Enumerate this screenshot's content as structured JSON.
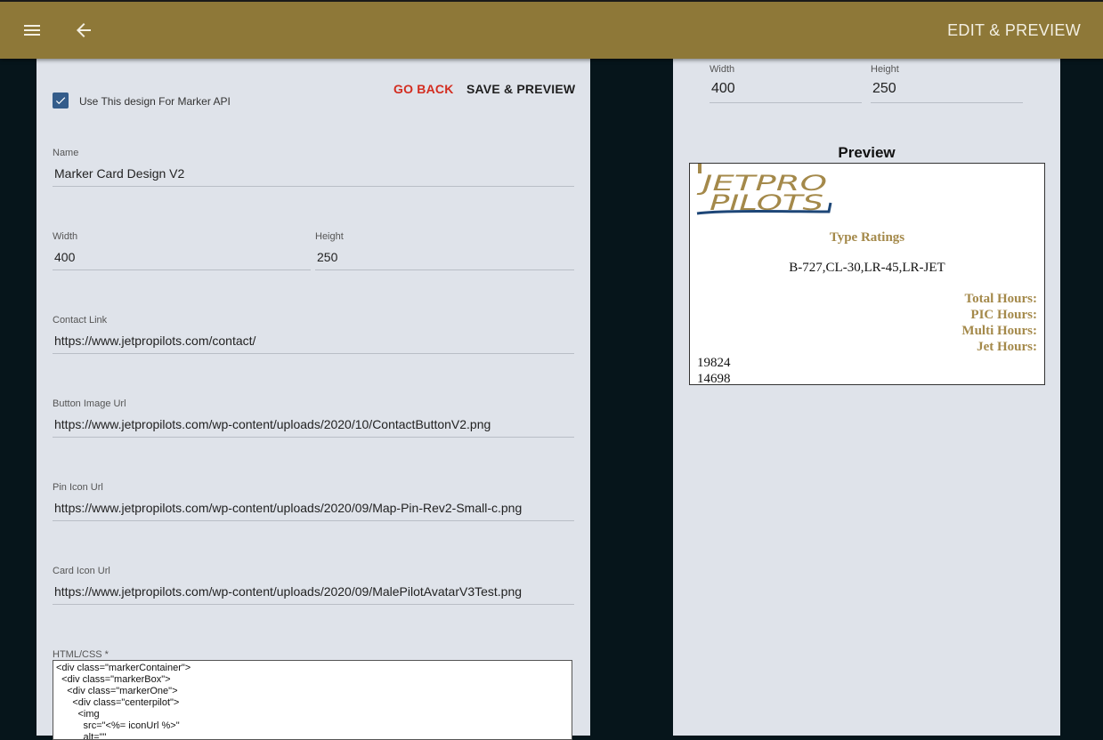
{
  "header": {
    "title": "EDIT & PREVIEW",
    "menu_icon": "hamburger-menu-icon",
    "back_icon": "arrow-left-icon",
    "color": "#8e7838"
  },
  "form": {
    "use_for_marker_api": {
      "label": "Use This design For Marker API",
      "checked": true
    },
    "go_back_label": "GO BACK",
    "save_preview_label": "SAVE & PREVIEW",
    "name": {
      "label": "Name",
      "value": "Marker Card Design V2"
    },
    "width": {
      "label": "Width",
      "value": "400"
    },
    "height": {
      "label": "Height",
      "value": "250"
    },
    "contact_link": {
      "label": "Contact Link",
      "value": "https://www.jetpropilots.com/contact/"
    },
    "button_image_url": {
      "label": "Button Image Url",
      "value": "https://www.jetpropilots.com/wp-content/uploads/2020/10/ContactButtonV2.png"
    },
    "pin_icon_url": {
      "label": "Pin Icon Url",
      "value": "https://www.jetpropilots.com/wp-content/uploads/2020/09/Map-Pin-Rev2-Small-c.png"
    },
    "card_icon_url": {
      "label": "Card Icon Url",
      "value": "https://www.jetpropilots.com/wp-content/uploads/2020/09/MalePilotAvatarV3Test.png"
    },
    "html_css": {
      "label": "HTML/CSS *",
      "value": "<div class=\"markerContainer\">\n  <div class=\"markerBox\">\n    <div class=\"markerOne\">\n      <div class=\"centerpilot\">\n        <img\n          src=\"<%= iconUrl %>\"\n          alt=\"\""
    }
  },
  "right": {
    "width": {
      "label": "Width",
      "value": "400"
    },
    "height": {
      "label": "Height",
      "value": "250"
    },
    "preview_title": "Preview",
    "card": {
      "logo_text_line1": "JETPRO",
      "logo_text_line2": "PILOTS",
      "type_ratings_title": "Type Ratings",
      "type_ratings_value": "B-727,CL-30,LR-45,LR-JET",
      "total_hours_label": "Total Hours:",
      "pic_hours_label": "PIC Hours:",
      "multi_hours_label": "Multi Hours:",
      "jet_hours_label": "Jet Hours:",
      "value_1": "19824",
      "value_2": "14698"
    }
  }
}
